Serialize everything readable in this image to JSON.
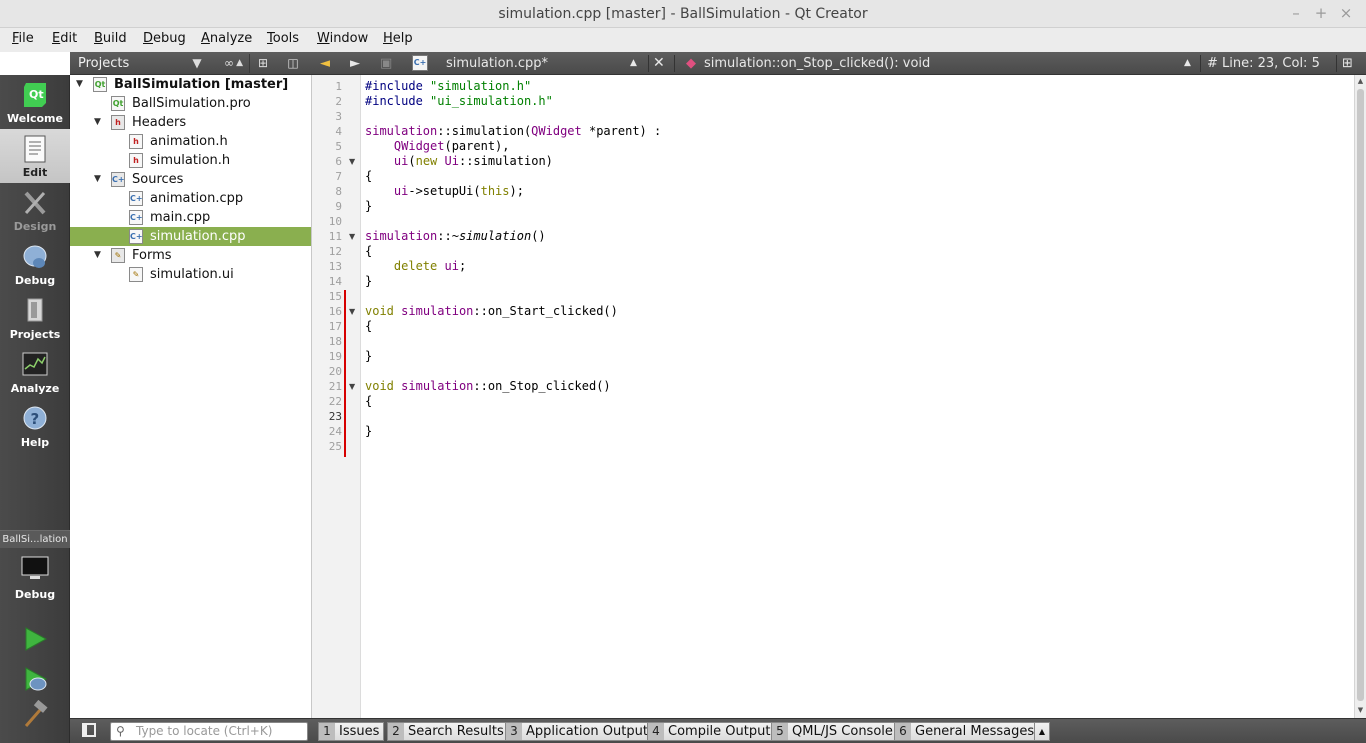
{
  "window": {
    "title": "simulation.cpp [master] - BallSimulation - Qt Creator",
    "minimize": "–",
    "maximize": "+",
    "close": "×"
  },
  "menubar": [
    "File",
    "Edit",
    "Build",
    "Debug",
    "Analyze",
    "Tools",
    "Window",
    "Help"
  ],
  "modes": [
    {
      "label": "Welcome",
      "icon": "qt-logo-icon",
      "state": "normal"
    },
    {
      "label": "Edit",
      "icon": "document-icon",
      "state": "active"
    },
    {
      "label": "Design",
      "icon": "design-tools-icon",
      "state": "disabled"
    },
    {
      "label": "Debug",
      "icon": "debug-bug-icon",
      "state": "normal"
    },
    {
      "label": "Projects",
      "icon": "projects-wrench-icon",
      "state": "normal"
    },
    {
      "label": "Analyze",
      "icon": "analyze-oscilloscope-icon",
      "state": "normal"
    },
    {
      "label": "Help",
      "icon": "help-question-icon",
      "state": "normal"
    }
  ],
  "kit": {
    "project": "BallSi...lation",
    "build_config": "Debug"
  },
  "navigator": {
    "view": "Projects",
    "tree": [
      {
        "label": "BallSimulation [master]",
        "level": 0,
        "type": "project",
        "expanded": true
      },
      {
        "label": "BallSimulation.pro",
        "level": 1,
        "type": "pro-file"
      },
      {
        "label": "Headers",
        "level": 1,
        "type": "folder",
        "expanded": true
      },
      {
        "label": "animation.h",
        "level": 2,
        "type": "h-file"
      },
      {
        "label": "simulation.h",
        "level": 2,
        "type": "h-file"
      },
      {
        "label": "Sources",
        "level": 1,
        "type": "folder",
        "expanded": true
      },
      {
        "label": "animation.cpp",
        "level": 2,
        "type": "cpp-file"
      },
      {
        "label": "main.cpp",
        "level": 2,
        "type": "cpp-file"
      },
      {
        "label": "simulation.cpp",
        "level": 2,
        "type": "cpp-file",
        "selected": true
      },
      {
        "label": "Forms",
        "level": 1,
        "type": "folder",
        "expanded": true
      },
      {
        "label": "simulation.ui",
        "level": 2,
        "type": "ui-file"
      }
    ]
  },
  "editor": {
    "filename": "simulation.cpp*",
    "symbol": "simulation::on_Stop_clicked(): void",
    "position_hash": "#",
    "position": "Line: 23, Col: 5",
    "current_line": 23,
    "lines": [
      "#include \"simulation.h\"",
      "#include \"ui_simulation.h\"",
      "",
      "simulation::simulation(QWidget *parent) :",
      "    QWidget(parent),",
      "    ui(new Ui::simulation)",
      "{",
      "    ui->setupUi(this);",
      "}",
      "",
      "simulation::~simulation()",
      "{",
      "    delete ui;",
      "}",
      "",
      "void simulation::on_Start_clicked()",
      "{",
      "",
      "}",
      "",
      "void simulation::on_Stop_clicked()",
      "{",
      "",
      "}",
      ""
    ],
    "fold_markers": [
      6,
      11,
      16,
      21
    ]
  },
  "outputpane": {
    "locator_placeholder": "Type to locate (Ctrl+K)",
    "tabs": [
      {
        "num": "1",
        "label": "Issues"
      },
      {
        "num": "2",
        "label": "Search Results"
      },
      {
        "num": "3",
        "label": "Application Output"
      },
      {
        "num": "4",
        "label": "Compile Output"
      },
      {
        "num": "5",
        "label": "QML/JS Console"
      },
      {
        "num": "6",
        "label": "General Messages"
      }
    ]
  },
  "colors": {
    "selection": "#8aaf4f",
    "keyword": "#808000",
    "type": "#800080",
    "string": "#008000",
    "revision_marker": "#d60000"
  }
}
